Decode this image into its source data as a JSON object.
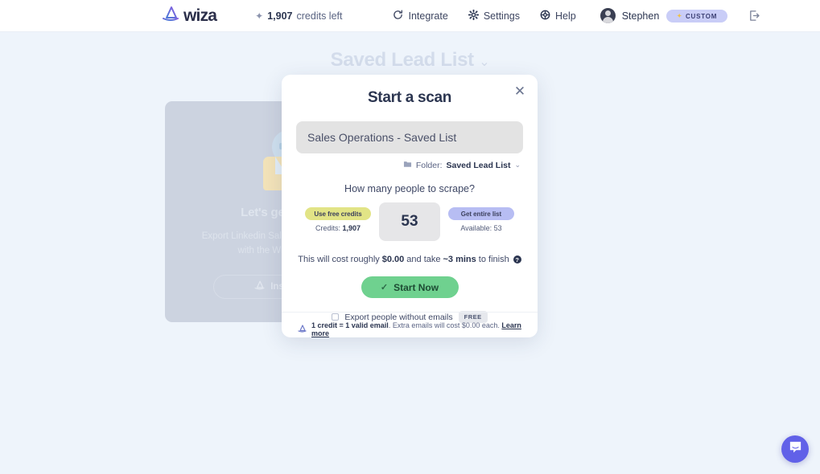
{
  "header": {
    "brand": "wiza",
    "brand_icon": "wiza-sail-logo",
    "credits_count": "1,907",
    "credits_label": "credits left",
    "integrate": "Integrate",
    "settings": "Settings",
    "help": "Help",
    "user_name": "Stephen",
    "plan_badge": "CUSTOM",
    "logout_icon": "logout-icon"
  },
  "page": {
    "title": "Saved Lead List",
    "empty_state": {
      "heading": "Let's get started!",
      "body": "Export Linkedin Sales Navigator searches with the Wiza extension.",
      "install_button": "Install Wiza"
    }
  },
  "modal": {
    "title": "Start a scan",
    "close_icon": "close-icon",
    "list_name": "Sales Operations - Saved List",
    "folder_icon": "folder-icon",
    "folder_label": "Folder:",
    "folder_value": "Saved Lead List",
    "question": "How many people to scrape?",
    "free_credits_pill": "Use free credits",
    "credits_sub_label": "Credits:",
    "credits_sub_value": "1,907",
    "scrape_count": "53",
    "entire_list_pill": "Get entire list",
    "available_label": "Available: 53",
    "cost_prefix": "This will cost roughly",
    "cost_amount": "$0.00",
    "cost_middle": "and take",
    "cost_time": "~3 mins",
    "cost_suffix": "to finish",
    "help_icon": "question-mark-icon",
    "start_button": "Start Now",
    "start_check_icon": "check-icon",
    "export_checkbox_label": "Export people without emails",
    "export_free_badge": "FREE",
    "footer_bold": "1 credit = 1 valid email",
    "footer_text": ". Extra emails will cost $0.00 each.",
    "footer_link": "Learn more",
    "footer_icon": "wiza-sail-logo"
  },
  "chat": {
    "icon": "intercom-chat-icon"
  },
  "colors": {
    "page_bg": "#eef4fb",
    "accent_green": "#6fd18f",
    "pill_yellow": "#e2e486",
    "pill_purple": "#b7bdf3",
    "badge_purple": "#c9cdf7",
    "chat_purple": "#6161e8",
    "text_dark": "#2b3550"
  }
}
